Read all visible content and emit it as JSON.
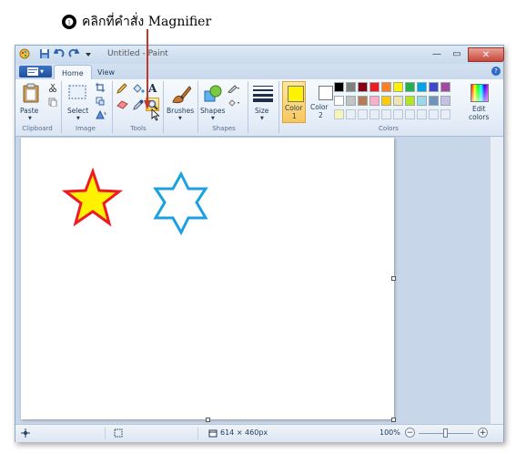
{
  "annotation": {
    "step": "❶",
    "text": "คลิกที่คำสั่ง Magnifier"
  },
  "window": {
    "title": "Untitled - Paint"
  },
  "tabs": {
    "file_caret": "▼",
    "home": "Home",
    "view": "View",
    "help": "?"
  },
  "titlebar_buttons": {
    "minimize": "—",
    "maximize": "▭",
    "close": "✕"
  },
  "ribbon": {
    "clipboard": {
      "paste": "Paste",
      "group": "Clipboard"
    },
    "image": {
      "select": "Select",
      "group": "Image"
    },
    "tools": {
      "group": "Tools"
    },
    "brushes": {
      "label": "Brushes"
    },
    "shapes": {
      "label": "Shapes",
      "group": "Shapes"
    },
    "size": {
      "label": "Size"
    },
    "colors": {
      "color1": "Color\n1",
      "color1_a": "Color",
      "color1_b": "1",
      "color2_a": "Color",
      "color2_b": "2",
      "edit_a": "Edit",
      "edit_b": "colors",
      "group": "Colors",
      "palette_row1": [
        "#000000",
        "#7f7f7f",
        "#880015",
        "#ed1c24",
        "#ff7f27",
        "#fff200",
        "#22b14c",
        "#00a2e8",
        "#3f48cc",
        "#a349a4"
      ],
      "palette_row2": [
        "#ffffff",
        "#c3c3c3",
        "#b97a57",
        "#ffaec9",
        "#ffc90e",
        "#efe4b0",
        "#b5e61d",
        "#99d9ea",
        "#7092be",
        "#c8bfe7"
      ],
      "palette_row3_first": "#f5f5b8"
    }
  },
  "canvas": {
    "shapes": [
      {
        "name": "star",
        "fill": "#fff200",
        "stroke": "#ed1c24"
      },
      {
        "name": "hexagram",
        "fill": "none",
        "stroke": "#1ba1e2"
      }
    ]
  },
  "status": {
    "canvas_size": "614 × 460px",
    "zoom": "100%",
    "zoom_minus": "−",
    "zoom_plus": "+"
  }
}
